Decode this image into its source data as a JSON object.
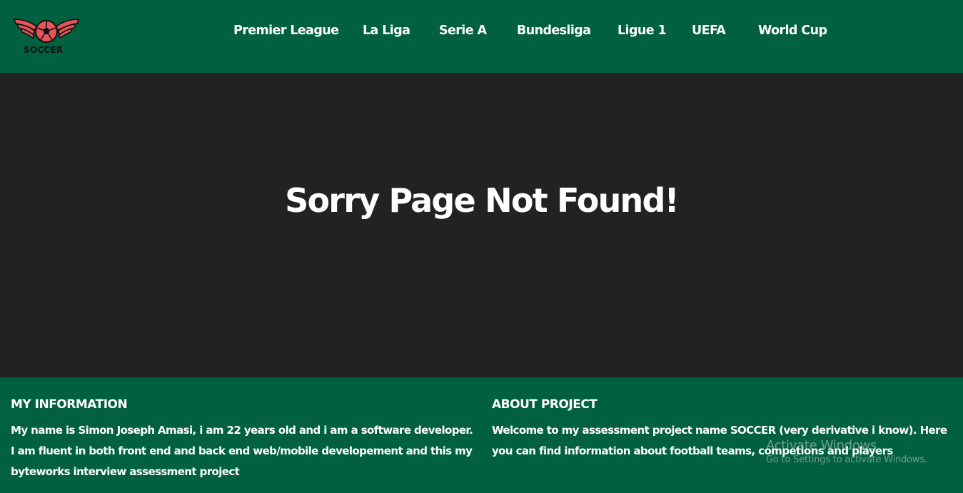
{
  "colors": {
    "header_bg": "#006040",
    "main_bg": "#222222",
    "footer_bg": "#006040",
    "logo_accent": "#e8545a",
    "text": "#ffffff"
  },
  "header": {
    "logo": {
      "text": "SOCCER",
      "icon": "soccer-ball-wings-icon"
    },
    "nav": [
      {
        "label": "Premier League"
      },
      {
        "label": "La Liga"
      },
      {
        "label": "Serie A"
      },
      {
        "label": "Bundesliga"
      },
      {
        "label": "Ligue 1"
      },
      {
        "label": "UEFA"
      },
      {
        "label": "World Cup"
      }
    ]
  },
  "main": {
    "title": "Sorry Page Not Found!"
  },
  "footer": {
    "my_info": {
      "heading": "MY INFORMATION",
      "text": "My name is Simon Joseph Amasi, i am 22 years old and i am a software developer. I am fluent in both front end and back end web/mobile developement and this my byteworks interview assessment project"
    },
    "about": {
      "heading": "ABOUT PROJECT",
      "text": "Welcome to my assessment project name SOCCER (very derivative i know). Here you can find information about football teams, competions and players"
    }
  },
  "watermark": {
    "line1": "Activate Windows",
    "line2": "Go to Settings to activate Windows."
  }
}
